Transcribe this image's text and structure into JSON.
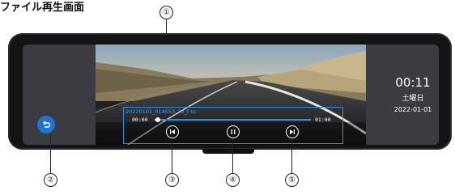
{
  "page": {
    "title": "ファイル再生画面"
  },
  "callouts": {
    "c1": "①",
    "c2": "②",
    "c3": "③",
    "c4": "④",
    "c5": "⑤"
  },
  "player": {
    "filename": "20220101_014553_13_F.ts",
    "current_time": "00:00",
    "duration": "01:00",
    "progress": 0.02
  },
  "clock": {
    "time": "00:11",
    "weekday": "土曜日",
    "date": "2022-01-01"
  },
  "icons": {
    "back": "back-arrow-icon",
    "previous": "skip-previous-icon",
    "pause": "pause-icon",
    "next": "skip-next-icon"
  },
  "colors": {
    "accent": "#2e8ee6",
    "back_button": "#1c74d4",
    "device": "#141414",
    "screen": "#3b3c41"
  }
}
